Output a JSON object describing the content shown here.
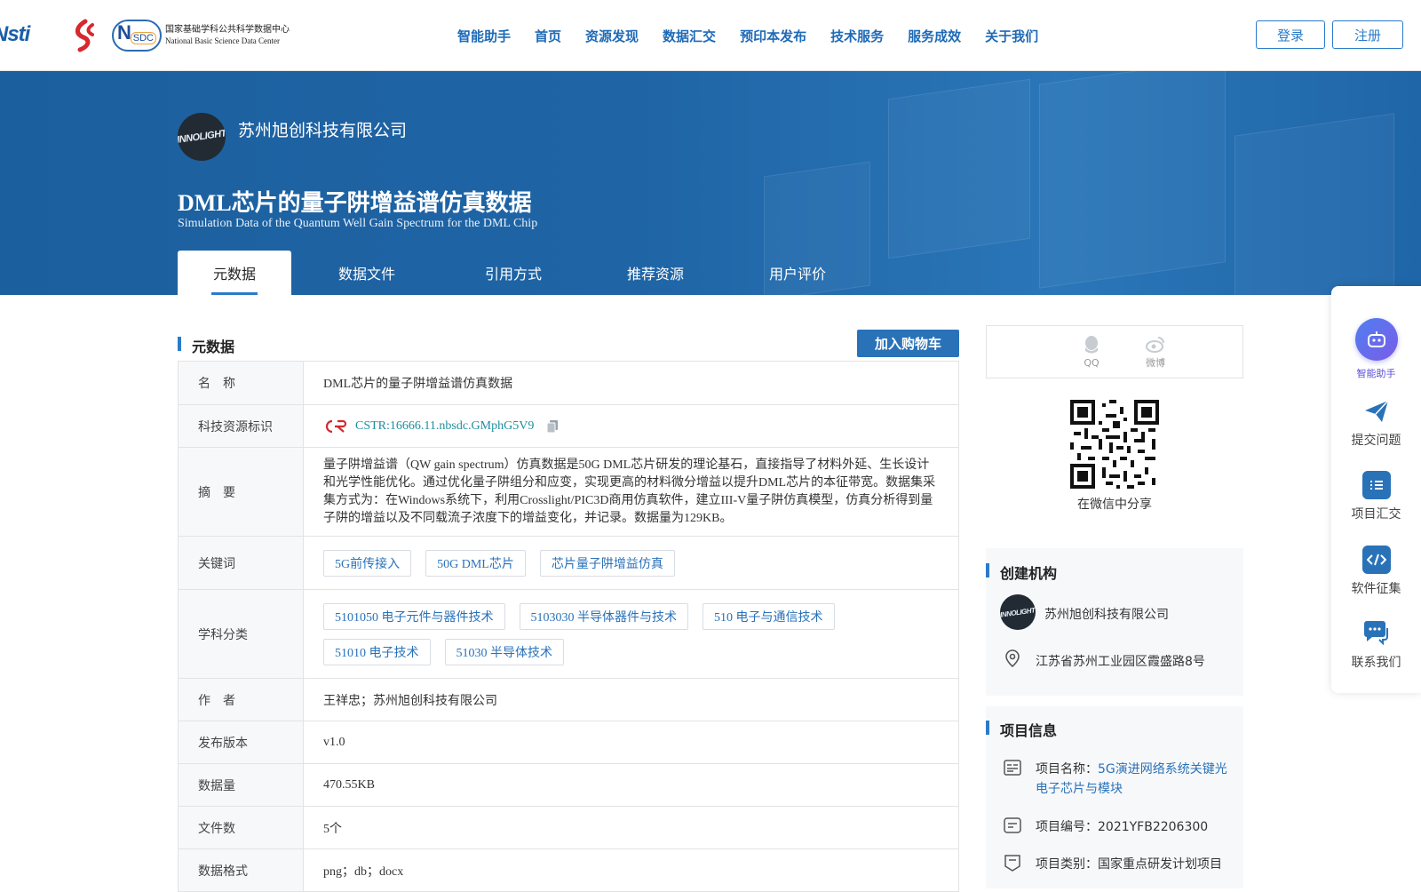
{
  "header": {
    "logos": {
      "nsti": "Nsti",
      "nsdc_badge": "N",
      "nsdc_small": "SDC",
      "nsdc_cn": "国家基础学科公共科学数据中心",
      "nsdc_en": "National Basic Science Data Center"
    },
    "nav": [
      "智能助手",
      "首页",
      "资源发现",
      "数据汇交",
      "预印本发布",
      "技术服务",
      "服务成效",
      "关于我们"
    ],
    "login": "登录",
    "register": "注册"
  },
  "banner": {
    "org_logo_text": "INNOLIGHT",
    "org_name": "苏州旭创科技有限公司",
    "title_cn": "DML芯片的量子阱增益谱仿真数据",
    "title_en": "Simulation Data of the Quantum Well Gain Spectrum for the DML Chip",
    "tabs": [
      "元数据",
      "数据文件",
      "引用方式",
      "推荐资源",
      "用户评价"
    ]
  },
  "main": {
    "section_title": "元数据",
    "cart_button": "加入购物车",
    "rows": {
      "name": {
        "k": "名　称",
        "v": "DML芯片的量子阱增益谱仿真数据"
      },
      "id": {
        "k": "科技资源标识",
        "v": "CSTR:16666.11.nbsdc.GMphG5V9"
      },
      "abstract": {
        "k": "摘　要",
        "v": "量子阱增益谱（QW gain spectrum）仿真数据是50G DML芯片研发的理论基石，直接指导了材料外延、生长设计和光学性能优化。通过优化量子阱组分和应变，实现更高的材料微分增益以提升DML芯片的本征带宽。数据集采集方式为：在Windows系统下，利用Crosslight/PIC3D商用仿真软件，建立III-V量子阱仿真模型，仿真分析得到量子阱的增益以及不同载流子浓度下的增益变化，并记录。数据量为129KB。"
      },
      "keywords": {
        "k": "关键词",
        "tags": [
          "5G前传接入",
          "50G DML芯片",
          "芯片量子阱增益仿真"
        ]
      },
      "subjects": {
        "k": "学科分类",
        "tags": [
          "5101050 电子元件与器件技术",
          "5103030 半导体器件与技术",
          "510 电子与通信技术",
          "51010 电子技术",
          "51030 半导体技术"
        ]
      },
      "author": {
        "k": "作　者",
        "v": "王祥忠；苏州旭创科技有限公司"
      },
      "version": {
        "k": "发布版本",
        "v": "v1.0"
      },
      "size": {
        "k": "数据量",
        "v": "470.55KB"
      },
      "files": {
        "k": "文件数",
        "v": "5个"
      },
      "format": {
        "k": "数据格式",
        "v": "png；db；docx"
      }
    }
  },
  "side": {
    "share_qq": "QQ",
    "share_weibo": "微博",
    "qr_label": "在微信中分享",
    "creator_title": "创建机构",
    "creator_name": "苏州旭创科技有限公司",
    "creator_address": "江苏省苏州工业园区霞盛路8号",
    "project_title": "项目信息",
    "project_name_label": "项目名称：",
    "project_name_value": "5G演进网络系统关键光电子芯片与模块",
    "project_no": "项目编号：2021YFB2206300",
    "project_type": "项目类别：国家重点研发计划项目"
  },
  "float": [
    "智能助手",
    "提交问题",
    "项目汇交",
    "软件征集",
    "联系我们"
  ],
  "colors": {
    "primary": "#2a72b8",
    "banner": "#1f65a6"
  }
}
